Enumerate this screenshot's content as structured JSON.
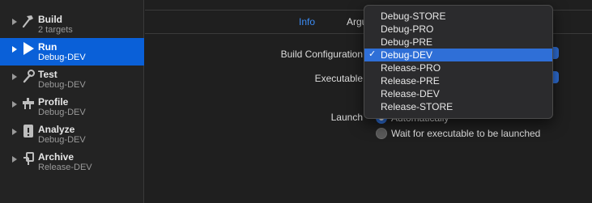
{
  "sidebar": {
    "items": [
      {
        "title": "Build",
        "subtitle": "2 targets",
        "icon": "hammer-icon"
      },
      {
        "title": "Run",
        "subtitle": "Debug-DEV",
        "icon": "play-icon"
      },
      {
        "title": "Test",
        "subtitle": "Debug-DEV",
        "icon": "wrench-icon"
      },
      {
        "title": "Profile",
        "subtitle": "Debug-DEV",
        "icon": "instruments-icon"
      },
      {
        "title": "Analyze",
        "subtitle": "Debug-DEV",
        "icon": "analyze-icon"
      },
      {
        "title": "Archive",
        "subtitle": "Release-DEV",
        "icon": "archive-icon"
      }
    ],
    "selected_index": 1
  },
  "tabs": {
    "info": "Info",
    "arguments": "Argu"
  },
  "form": {
    "build_configuration_label": "Build Configuration",
    "executable_label": "Executable",
    "launch_label": "Launch",
    "launch_options": [
      {
        "label": "Automatically",
        "selected": true
      },
      {
        "label": "Wait for executable to be launched",
        "selected": false
      }
    ]
  },
  "menu": {
    "items": [
      {
        "label": "Debug-STORE",
        "checked": false
      },
      {
        "label": "Debug-PRO",
        "checked": false
      },
      {
        "label": "Debug-PRE",
        "checked": false
      },
      {
        "label": "Debug-DEV",
        "checked": true
      },
      {
        "label": "Release-PRO",
        "checked": false
      },
      {
        "label": "Release-PRE",
        "checked": false
      },
      {
        "label": "Release-DEV",
        "checked": false
      },
      {
        "label": "Release-STORE",
        "checked": false
      }
    ],
    "check_glyph": "✓"
  },
  "colors": {
    "accent": "#2f6fd7",
    "selection": "#0a60d8",
    "active_tab": "#3b8cf5"
  }
}
